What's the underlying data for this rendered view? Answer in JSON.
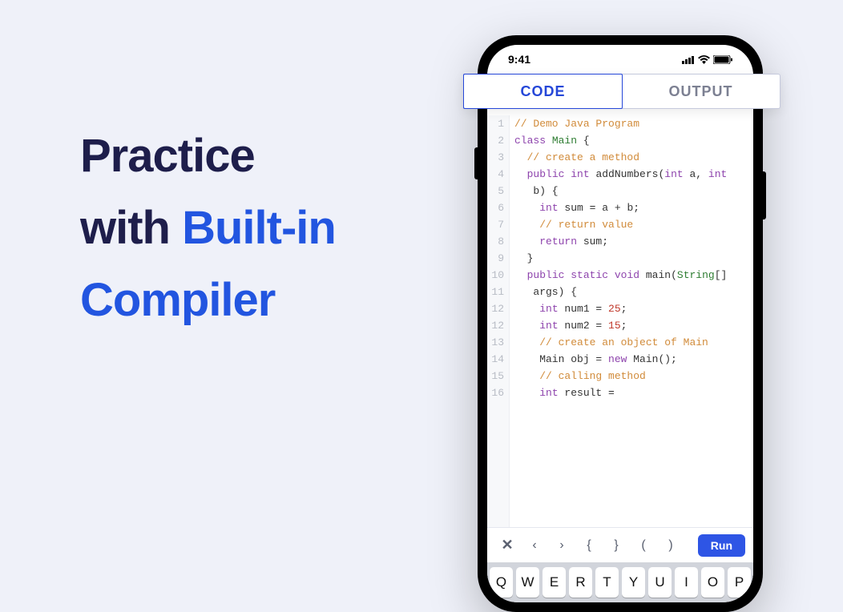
{
  "headline": {
    "line1": "Practice",
    "line2_plain": "with ",
    "line2_accent": "Built-in",
    "line3_accent": "Compiler"
  },
  "statusbar": {
    "time": "9:41"
  },
  "tabs": {
    "code": "CODE",
    "output": "OUTPUT"
  },
  "code_lines": [
    {
      "n": 1,
      "segments": [
        {
          "cls": "c-comment",
          "t": "// Demo Java Program"
        }
      ]
    },
    {
      "n": 2,
      "segments": [
        {
          "cls": "c-keyword",
          "t": "class"
        },
        {
          "t": " "
        },
        {
          "cls": "c-class",
          "t": "Main"
        },
        {
          "t": " {"
        }
      ]
    },
    {
      "n": 3,
      "segments": [
        {
          "t": "  "
        },
        {
          "cls": "c-comment",
          "t": "// create a method"
        }
      ]
    },
    {
      "n": 4,
      "segments": [
        {
          "t": "  "
        },
        {
          "cls": "c-keyword",
          "t": "public"
        },
        {
          "t": " "
        },
        {
          "cls": "c-type",
          "t": "int"
        },
        {
          "t": " addNumbers("
        },
        {
          "cls": "c-type",
          "t": "int"
        },
        {
          "t": " a, "
        },
        {
          "cls": "c-type",
          "t": "int"
        }
      ]
    },
    {
      "n": 5,
      "segments": [
        {
          "t": "   b) {"
        }
      ]
    },
    {
      "n": 6,
      "segments": [
        {
          "t": "    "
        },
        {
          "cls": "c-type",
          "t": "int"
        },
        {
          "t": " sum = a + b;"
        }
      ]
    },
    {
      "n": 7,
      "segments": [
        {
          "t": "    "
        },
        {
          "cls": "c-comment",
          "t": "// return value"
        }
      ]
    },
    {
      "n": 8,
      "segments": [
        {
          "t": "    "
        },
        {
          "cls": "c-keyword",
          "t": "return"
        },
        {
          "t": " sum;"
        }
      ]
    },
    {
      "n": 9,
      "segments": [
        {
          "t": "  }"
        }
      ]
    },
    {
      "n": 10,
      "segments": [
        {
          "t": "  "
        },
        {
          "cls": "c-keyword",
          "t": "public"
        },
        {
          "t": " "
        },
        {
          "cls": "c-keyword",
          "t": "static"
        },
        {
          "t": " "
        },
        {
          "cls": "c-type",
          "t": "void"
        },
        {
          "t": " main("
        },
        {
          "cls": "c-class",
          "t": "String"
        },
        {
          "t": "[]"
        }
      ]
    },
    {
      "n": 11,
      "segments": [
        {
          "t": "   args) {"
        }
      ]
    },
    {
      "n": 12,
      "segments": [
        {
          "t": "    "
        },
        {
          "cls": "c-type",
          "t": "int"
        },
        {
          "t": " num1 = "
        },
        {
          "cls": "c-num",
          "t": "25"
        },
        {
          "t": ";"
        }
      ]
    },
    {
      "n": 12,
      "segments": [
        {
          "t": "    "
        },
        {
          "cls": "c-type",
          "t": "int"
        },
        {
          "t": " num2 = "
        },
        {
          "cls": "c-num",
          "t": "15"
        },
        {
          "t": ";"
        }
      ]
    },
    {
      "n": 13,
      "segments": [
        {
          "t": "    "
        },
        {
          "cls": "c-comment",
          "t": "// create an object of Main"
        }
      ]
    },
    {
      "n": 14,
      "segments": [
        {
          "t": "    Main obj = "
        },
        {
          "cls": "c-keyword",
          "t": "new"
        },
        {
          "t": " Main();"
        }
      ]
    },
    {
      "n": 15,
      "segments": [
        {
          "t": "    "
        },
        {
          "cls": "c-comment",
          "t": "// calling method"
        }
      ]
    },
    {
      "n": 16,
      "segments": [
        {
          "t": "    "
        },
        {
          "cls": "c-type",
          "t": "int"
        },
        {
          "t": " result ="
        }
      ]
    }
  ],
  "toolbar": {
    "close": "✕",
    "prev": "‹",
    "next": "›",
    "lbrace": "{",
    "rbrace": "}",
    "lparen": "(",
    "rparen": ")",
    "run": "Run"
  },
  "keyboard_row": [
    "Q",
    "W",
    "E",
    "R",
    "T",
    "Y",
    "U",
    "I",
    "O",
    "P"
  ]
}
